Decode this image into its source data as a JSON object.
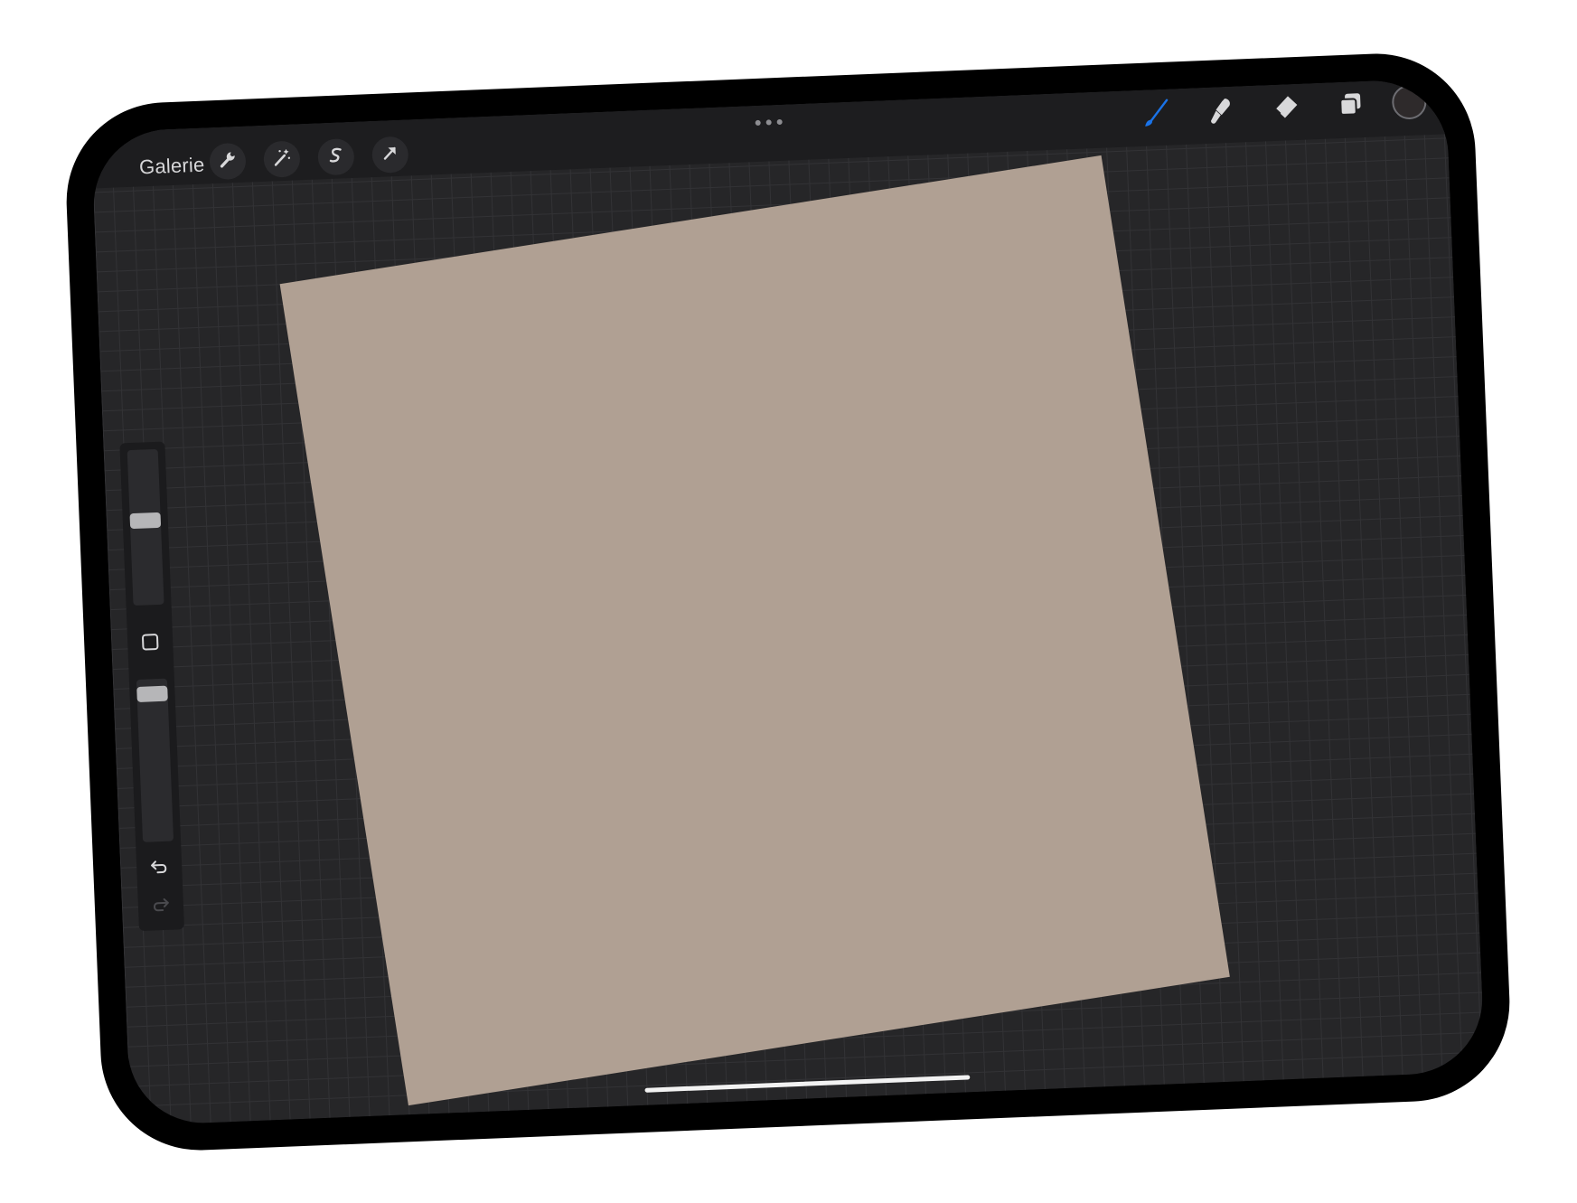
{
  "app": {
    "gallery_label": "Galerie"
  },
  "toolbar_left": [
    {
      "name": "actions",
      "icon": "wrench-icon"
    },
    {
      "name": "adjustments",
      "icon": "magic-wand-icon"
    },
    {
      "name": "selection",
      "icon": "selection-s-icon"
    },
    {
      "name": "transform",
      "icon": "arrow-cursor-icon"
    }
  ],
  "toolbar_right": [
    {
      "name": "brush",
      "icon": "brush-icon",
      "active": true
    },
    {
      "name": "smudge",
      "icon": "smudge-icon",
      "active": false
    },
    {
      "name": "eraser",
      "icon": "eraser-icon",
      "active": false
    },
    {
      "name": "layers",
      "icon": "layers-icon",
      "active": false
    }
  ],
  "colors": {
    "canvas_fill": "#b0a093",
    "active_tool": "#1a73e8",
    "device_frame": "#000000",
    "workspace": "#262628"
  },
  "side_panel": {
    "size_slider_level": 0.55,
    "opacity_slider_level": 0.05
  }
}
